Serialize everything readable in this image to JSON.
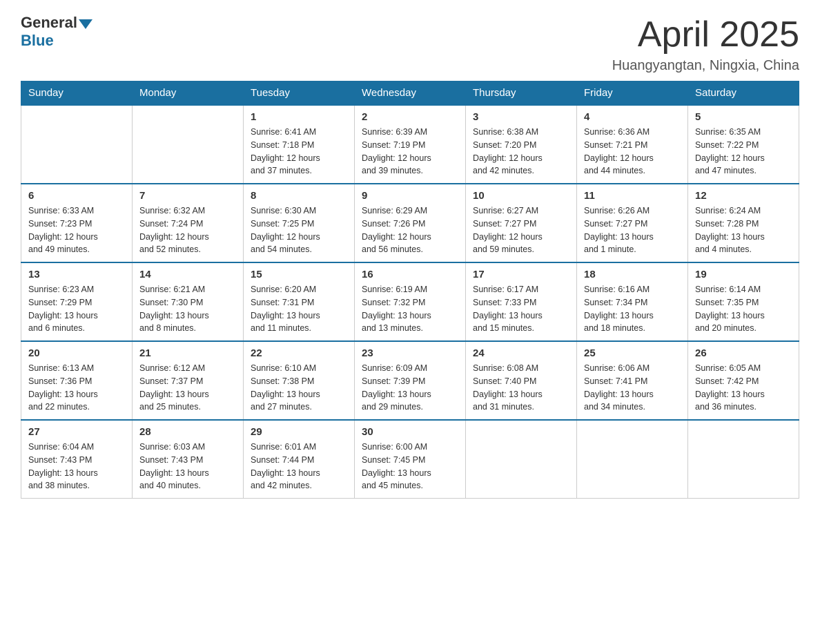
{
  "header": {
    "logo_general": "General",
    "logo_blue": "Blue",
    "title": "April 2025",
    "location": "Huangyangtan, Ningxia, China"
  },
  "weekdays": [
    "Sunday",
    "Monday",
    "Tuesday",
    "Wednesday",
    "Thursday",
    "Friday",
    "Saturday"
  ],
  "weeks": [
    [
      {
        "day": "",
        "info": ""
      },
      {
        "day": "",
        "info": ""
      },
      {
        "day": "1",
        "info": "Sunrise: 6:41 AM\nSunset: 7:18 PM\nDaylight: 12 hours\nand 37 minutes."
      },
      {
        "day": "2",
        "info": "Sunrise: 6:39 AM\nSunset: 7:19 PM\nDaylight: 12 hours\nand 39 minutes."
      },
      {
        "day": "3",
        "info": "Sunrise: 6:38 AM\nSunset: 7:20 PM\nDaylight: 12 hours\nand 42 minutes."
      },
      {
        "day": "4",
        "info": "Sunrise: 6:36 AM\nSunset: 7:21 PM\nDaylight: 12 hours\nand 44 minutes."
      },
      {
        "day": "5",
        "info": "Sunrise: 6:35 AM\nSunset: 7:22 PM\nDaylight: 12 hours\nand 47 minutes."
      }
    ],
    [
      {
        "day": "6",
        "info": "Sunrise: 6:33 AM\nSunset: 7:23 PM\nDaylight: 12 hours\nand 49 minutes."
      },
      {
        "day": "7",
        "info": "Sunrise: 6:32 AM\nSunset: 7:24 PM\nDaylight: 12 hours\nand 52 minutes."
      },
      {
        "day": "8",
        "info": "Sunrise: 6:30 AM\nSunset: 7:25 PM\nDaylight: 12 hours\nand 54 minutes."
      },
      {
        "day": "9",
        "info": "Sunrise: 6:29 AM\nSunset: 7:26 PM\nDaylight: 12 hours\nand 56 minutes."
      },
      {
        "day": "10",
        "info": "Sunrise: 6:27 AM\nSunset: 7:27 PM\nDaylight: 12 hours\nand 59 minutes."
      },
      {
        "day": "11",
        "info": "Sunrise: 6:26 AM\nSunset: 7:27 PM\nDaylight: 13 hours\nand 1 minute."
      },
      {
        "day": "12",
        "info": "Sunrise: 6:24 AM\nSunset: 7:28 PM\nDaylight: 13 hours\nand 4 minutes."
      }
    ],
    [
      {
        "day": "13",
        "info": "Sunrise: 6:23 AM\nSunset: 7:29 PM\nDaylight: 13 hours\nand 6 minutes."
      },
      {
        "day": "14",
        "info": "Sunrise: 6:21 AM\nSunset: 7:30 PM\nDaylight: 13 hours\nand 8 minutes."
      },
      {
        "day": "15",
        "info": "Sunrise: 6:20 AM\nSunset: 7:31 PM\nDaylight: 13 hours\nand 11 minutes."
      },
      {
        "day": "16",
        "info": "Sunrise: 6:19 AM\nSunset: 7:32 PM\nDaylight: 13 hours\nand 13 minutes."
      },
      {
        "day": "17",
        "info": "Sunrise: 6:17 AM\nSunset: 7:33 PM\nDaylight: 13 hours\nand 15 minutes."
      },
      {
        "day": "18",
        "info": "Sunrise: 6:16 AM\nSunset: 7:34 PM\nDaylight: 13 hours\nand 18 minutes."
      },
      {
        "day": "19",
        "info": "Sunrise: 6:14 AM\nSunset: 7:35 PM\nDaylight: 13 hours\nand 20 minutes."
      }
    ],
    [
      {
        "day": "20",
        "info": "Sunrise: 6:13 AM\nSunset: 7:36 PM\nDaylight: 13 hours\nand 22 minutes."
      },
      {
        "day": "21",
        "info": "Sunrise: 6:12 AM\nSunset: 7:37 PM\nDaylight: 13 hours\nand 25 minutes."
      },
      {
        "day": "22",
        "info": "Sunrise: 6:10 AM\nSunset: 7:38 PM\nDaylight: 13 hours\nand 27 minutes."
      },
      {
        "day": "23",
        "info": "Sunrise: 6:09 AM\nSunset: 7:39 PM\nDaylight: 13 hours\nand 29 minutes."
      },
      {
        "day": "24",
        "info": "Sunrise: 6:08 AM\nSunset: 7:40 PM\nDaylight: 13 hours\nand 31 minutes."
      },
      {
        "day": "25",
        "info": "Sunrise: 6:06 AM\nSunset: 7:41 PM\nDaylight: 13 hours\nand 34 minutes."
      },
      {
        "day": "26",
        "info": "Sunrise: 6:05 AM\nSunset: 7:42 PM\nDaylight: 13 hours\nand 36 minutes."
      }
    ],
    [
      {
        "day": "27",
        "info": "Sunrise: 6:04 AM\nSunset: 7:43 PM\nDaylight: 13 hours\nand 38 minutes."
      },
      {
        "day": "28",
        "info": "Sunrise: 6:03 AM\nSunset: 7:43 PM\nDaylight: 13 hours\nand 40 minutes."
      },
      {
        "day": "29",
        "info": "Sunrise: 6:01 AM\nSunset: 7:44 PM\nDaylight: 13 hours\nand 42 minutes."
      },
      {
        "day": "30",
        "info": "Sunrise: 6:00 AM\nSunset: 7:45 PM\nDaylight: 13 hours\nand 45 minutes."
      },
      {
        "day": "",
        "info": ""
      },
      {
        "day": "",
        "info": ""
      },
      {
        "day": "",
        "info": ""
      }
    ]
  ]
}
